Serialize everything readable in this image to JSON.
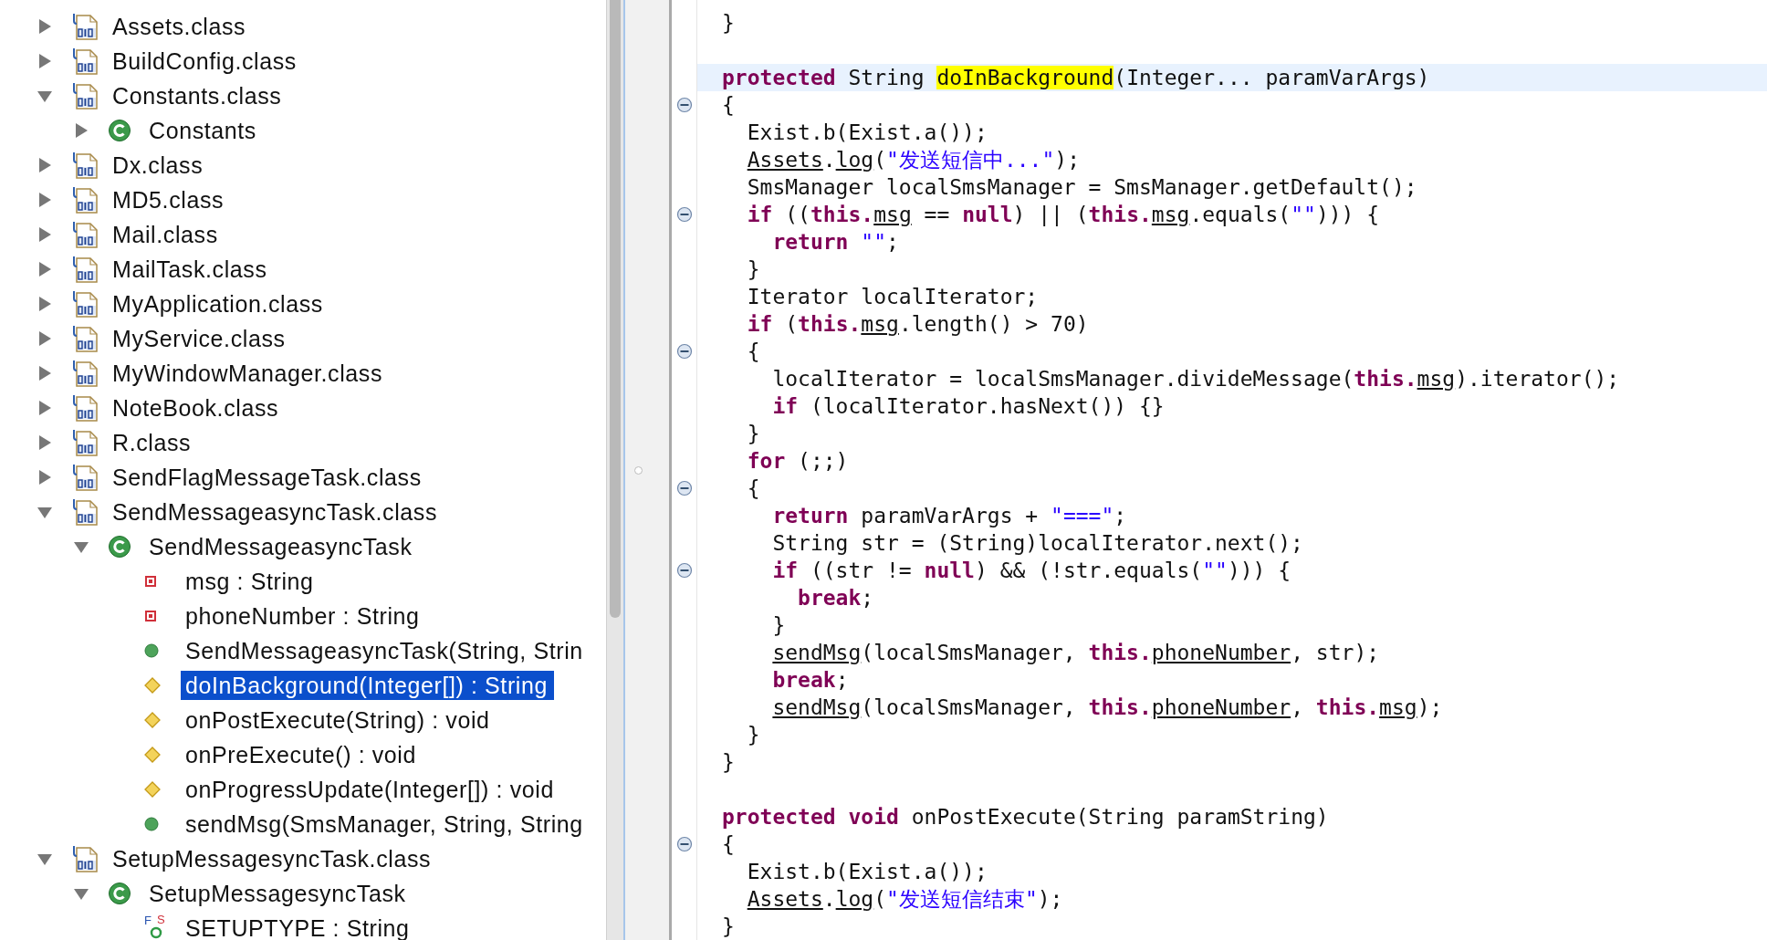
{
  "tree": {
    "items": [
      {
        "label": "Assets.class",
        "kind": "class-file",
        "expanded": false,
        "selected": false
      },
      {
        "label": "BuildConfig.class",
        "kind": "class-file",
        "expanded": false,
        "selected": false
      },
      {
        "label": "Constants.class",
        "kind": "class-file",
        "expanded": true,
        "selected": false,
        "children": [
          {
            "label": "Constants",
            "kind": "class",
            "expanded": false,
            "selected": false
          }
        ]
      },
      {
        "label": "Dx.class",
        "kind": "class-file",
        "expanded": false,
        "selected": false
      },
      {
        "label": "MD5.class",
        "kind": "class-file",
        "expanded": false,
        "selected": false
      },
      {
        "label": "Mail.class",
        "kind": "class-file",
        "expanded": false,
        "selected": false
      },
      {
        "label": "MailTask.class",
        "kind": "class-file",
        "expanded": false,
        "selected": false
      },
      {
        "label": "MyApplication.class",
        "kind": "class-file",
        "expanded": false,
        "selected": false
      },
      {
        "label": "MyService.class",
        "kind": "class-file",
        "expanded": false,
        "selected": false
      },
      {
        "label": "MyWindowManager.class",
        "kind": "class-file",
        "expanded": false,
        "selected": false
      },
      {
        "label": "NoteBook.class",
        "kind": "class-file",
        "expanded": false,
        "selected": false
      },
      {
        "label": "R.class",
        "kind": "class-file",
        "expanded": false,
        "selected": false
      },
      {
        "label": "SendFlagMessageTask.class",
        "kind": "class-file",
        "expanded": false,
        "selected": false
      },
      {
        "label": "SendMessageasyncTask.class",
        "kind": "class-file",
        "expanded": true,
        "selected": false,
        "children": [
          {
            "label": "SendMessageasyncTask",
            "kind": "class",
            "expanded": true,
            "selected": false,
            "children": [
              {
                "label": "msg : String",
                "kind": "private-field",
                "selected": false
              },
              {
                "label": "phoneNumber : String",
                "kind": "private-field",
                "selected": false
              },
              {
                "label": "SendMessageasyncTask(String, Strin",
                "kind": "public-method",
                "selected": false
              },
              {
                "label": "doInBackground(Integer[]) : String",
                "kind": "protected-method",
                "selected": true
              },
              {
                "label": "onPostExecute(String) : void",
                "kind": "protected-method",
                "selected": false
              },
              {
                "label": "onPreExecute() : void",
                "kind": "protected-method",
                "selected": false
              },
              {
                "label": "onProgressUpdate(Integer[]) : void",
                "kind": "protected-method",
                "selected": false
              },
              {
                "label": "sendMsg(SmsManager, String, String",
                "kind": "public-method",
                "selected": false
              }
            ]
          }
        ]
      },
      {
        "label": "SetupMessagesyncTask.class",
        "kind": "class-file",
        "expanded": true,
        "selected": false,
        "children": [
          {
            "label": "SetupMessagesyncTask",
            "kind": "class",
            "expanded": true,
            "selected": false,
            "children": [
              {
                "label": "SETUPTYPE : String",
                "kind": "static-final-field",
                "icon_marks": [
                  "F",
                  "S"
                ],
                "selected": false
              }
            ]
          }
        ]
      }
    ]
  },
  "code": {
    "lines": [
      {
        "kind": "code",
        "segments": [
          {
            "kind": "plain",
            "text": "}"
          }
        ]
      },
      {
        "kind": "blank"
      },
      {
        "kind": "code",
        "current": true,
        "segments": [
          {
            "kind": "keyword",
            "text": "protected"
          },
          {
            "kind": "plain",
            "text": " String "
          },
          {
            "kind": "highlight",
            "text": "doInBackground"
          },
          {
            "kind": "plain",
            "text": "(Integer... paramVarArgs)"
          }
        ]
      },
      {
        "kind": "code",
        "fold": true,
        "segments": [
          {
            "kind": "plain",
            "text": "{"
          }
        ],
        "children": [
          {
            "kind": "code",
            "segments": [
              {
                "kind": "plain",
                "text": "Exist.b(Exist.a());"
              }
            ]
          },
          {
            "kind": "code",
            "segments": [
              {
                "kind": "ref",
                "text": "Assets"
              },
              {
                "kind": "plain",
                "text": "."
              },
              {
                "kind": "ref",
                "text": "log"
              },
              {
                "kind": "plain",
                "text": "("
              },
              {
                "kind": "string",
                "text": "\"发送短信中...\""
              },
              {
                "kind": "plain",
                "text": ");"
              }
            ]
          },
          {
            "kind": "code",
            "segments": [
              {
                "kind": "plain",
                "text": "SmsManager localSmsManager = SmsManager.getDefault();"
              }
            ]
          },
          {
            "kind": "code",
            "fold": true,
            "segments": [
              {
                "kind": "keyword",
                "text": "if"
              },
              {
                "kind": "plain",
                "text": " (("
              },
              {
                "kind": "keyword",
                "text": "this."
              },
              {
                "kind": "ref",
                "text": "msg"
              },
              {
                "kind": "plain",
                "text": " == "
              },
              {
                "kind": "keyword",
                "text": "null"
              },
              {
                "kind": "plain",
                "text": ") || ("
              },
              {
                "kind": "keyword",
                "text": "this."
              },
              {
                "kind": "ref",
                "text": "msg"
              },
              {
                "kind": "plain",
                "text": ".equals("
              },
              {
                "kind": "string",
                "text": "\"\""
              },
              {
                "kind": "plain",
                "text": "))) {"
              }
            ],
            "children": [
              {
                "kind": "code",
                "segments": [
                  {
                    "kind": "keyword",
                    "text": "return "
                  },
                  {
                    "kind": "string",
                    "text": "\"\""
                  },
                  {
                    "kind": "plain",
                    "text": ";"
                  }
                ]
              }
            ]
          },
          {
            "kind": "code",
            "segments": [
              {
                "kind": "plain",
                "text": "}"
              }
            ]
          },
          {
            "kind": "code",
            "segments": [
              {
                "kind": "plain",
                "text": "Iterator localIterator;"
              }
            ]
          },
          {
            "kind": "code",
            "segments": [
              {
                "kind": "keyword",
                "text": "if"
              },
              {
                "kind": "plain",
                "text": " ("
              },
              {
                "kind": "keyword",
                "text": "this."
              },
              {
                "kind": "ref",
                "text": "msg"
              },
              {
                "kind": "plain",
                "text": ".length() > 70)"
              }
            ]
          },
          {
            "kind": "code",
            "fold": true,
            "segments": [
              {
                "kind": "plain",
                "text": "{"
              }
            ],
            "children": [
              {
                "kind": "code",
                "segments": [
                  {
                    "kind": "plain",
                    "text": "localIterator = localSmsManager.divideMessage("
                  },
                  {
                    "kind": "keyword",
                    "text": "this."
                  },
                  {
                    "kind": "ref",
                    "text": "msg"
                  },
                  {
                    "kind": "plain",
                    "text": ").iterator();"
                  }
                ]
              },
              {
                "kind": "code",
                "segments": [
                  {
                    "kind": "keyword",
                    "text": "if"
                  },
                  {
                    "kind": "plain",
                    "text": " (localIterator.hasNext()) {}"
                  }
                ]
              }
            ]
          },
          {
            "kind": "code",
            "segments": [
              {
                "kind": "plain",
                "text": "}"
              }
            ]
          },
          {
            "kind": "code",
            "segments": [
              {
                "kind": "keyword",
                "text": "for"
              },
              {
                "kind": "plain",
                "text": " (;;)"
              }
            ]
          },
          {
            "kind": "code",
            "fold": true,
            "segments": [
              {
                "kind": "plain",
                "text": "{"
              }
            ],
            "children": [
              {
                "kind": "code",
                "segments": [
                  {
                    "kind": "keyword",
                    "text": "return"
                  },
                  {
                    "kind": "plain",
                    "text": " paramVarArgs + "
                  },
                  {
                    "kind": "string",
                    "text": "\"===\""
                  },
                  {
                    "kind": "plain",
                    "text": ";"
                  }
                ]
              },
              {
                "kind": "code",
                "segments": [
                  {
                    "kind": "plain",
                    "text": "String str = (String)localIterator.next();"
                  }
                ]
              },
              {
                "kind": "code",
                "fold": true,
                "segments": [
                  {
                    "kind": "keyword",
                    "text": "if"
                  },
                  {
                    "kind": "plain",
                    "text": " ((str != "
                  },
                  {
                    "kind": "keyword",
                    "text": "null"
                  },
                  {
                    "kind": "plain",
                    "text": ") && (!str.equals("
                  },
                  {
                    "kind": "string",
                    "text": "\"\""
                  },
                  {
                    "kind": "plain",
                    "text": "))) {"
                  }
                ],
                "children": [
                  {
                    "kind": "code",
                    "segments": [
                      {
                        "kind": "keyword",
                        "text": "break"
                      },
                      {
                        "kind": "plain",
                        "text": ";"
                      }
                    ]
                  }
                ]
              },
              {
                "kind": "code",
                "segments": [
                  {
                    "kind": "plain",
                    "text": "}"
                  }
                ]
              },
              {
                "kind": "code",
                "segments": [
                  {
                    "kind": "ref",
                    "text": "sendMsg"
                  },
                  {
                    "kind": "plain",
                    "text": "(localSmsManager, "
                  },
                  {
                    "kind": "keyword",
                    "text": "this."
                  },
                  {
                    "kind": "ref",
                    "text": "phoneNumber"
                  },
                  {
                    "kind": "plain",
                    "text": ", str);"
                  }
                ]
              },
              {
                "kind": "code",
                "segments": [
                  {
                    "kind": "keyword",
                    "text": "break"
                  },
                  {
                    "kind": "plain",
                    "text": ";"
                  }
                ]
              },
              {
                "kind": "code",
                "segments": [
                  {
                    "kind": "ref",
                    "text": "sendMsg"
                  },
                  {
                    "kind": "plain",
                    "text": "(localSmsManager, "
                  },
                  {
                    "kind": "keyword",
                    "text": "this."
                  },
                  {
                    "kind": "ref",
                    "text": "phoneNumber"
                  },
                  {
                    "kind": "plain",
                    "text": ", "
                  },
                  {
                    "kind": "keyword",
                    "text": "this."
                  },
                  {
                    "kind": "ref",
                    "text": "msg"
                  },
                  {
                    "kind": "plain",
                    "text": ");"
                  }
                ]
              }
            ]
          },
          {
            "kind": "code",
            "segments": [
              {
                "kind": "plain",
                "text": "}"
              }
            ]
          }
        ]
      },
      {
        "kind": "code",
        "segments": [
          {
            "kind": "plain",
            "text": "}"
          }
        ]
      },
      {
        "kind": "blank"
      },
      {
        "kind": "code",
        "segments": [
          {
            "kind": "keyword",
            "text": "protected void"
          },
          {
            "kind": "plain",
            "text": " onPostExecute(String paramString)"
          }
        ]
      },
      {
        "kind": "code",
        "fold": true,
        "segments": [
          {
            "kind": "plain",
            "text": "{"
          }
        ],
        "children": [
          {
            "kind": "code",
            "segments": [
              {
                "kind": "plain",
                "text": "Exist.b(Exist.a());"
              }
            ]
          },
          {
            "kind": "code",
            "segments": [
              {
                "kind": "ref",
                "text": "Assets"
              },
              {
                "kind": "plain",
                "text": "."
              },
              {
                "kind": "ref",
                "text": "log"
              },
              {
                "kind": "plain",
                "text": "("
              },
              {
                "kind": "string",
                "text": "\"发送短信结束\""
              },
              {
                "kind": "plain",
                "text": ");"
              }
            ]
          }
        ]
      },
      {
        "kind": "code",
        "segments": [
          {
            "kind": "plain",
            "text": "}"
          }
        ]
      }
    ]
  }
}
